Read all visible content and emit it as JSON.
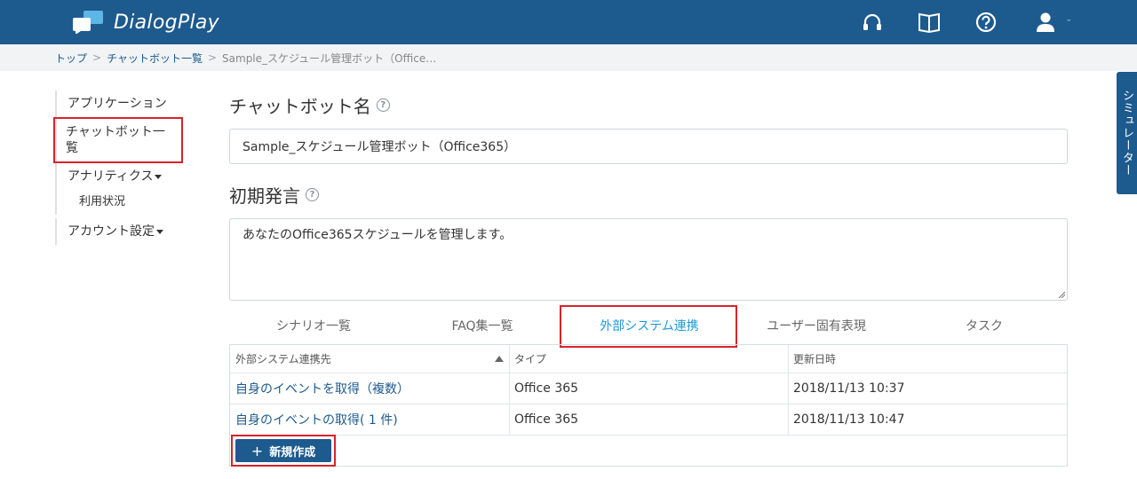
{
  "header": {
    "app_name": "DialogPlay",
    "icons": [
      "headset-icon",
      "book-icon",
      "help-icon",
      "user-icon"
    ],
    "accent_color": "#1d5a8e"
  },
  "breadcrumb": {
    "items": [
      "トップ",
      "チャットボット一覧"
    ],
    "current": "Sample_スケジュール管理ボット（Office…"
  },
  "sidebar": {
    "application": "アプリケーション",
    "chatbot_list": "チャットボット一覧",
    "analytics": "アナリティクス",
    "usage": "利用状況",
    "account": "アカウント設定"
  },
  "form": {
    "name_label": "チャットボット名",
    "name_value": "Sample_スケジュール管理ボット（Office365）",
    "initial_label": "初期発言",
    "initial_value": "あなたのOffice365スケジュールを管理します。"
  },
  "tabs": [
    "シナリオ一覧",
    "FAQ集一覧",
    "外部システム連携",
    "ユーザー固有表現",
    "タスク"
  ],
  "table": {
    "headers": [
      "外部システム連携先",
      "タイプ",
      "更新日時"
    ],
    "rows": [
      [
        "自身のイベントを取得（複数）",
        "Office 365",
        "2018/11/13 10:37"
      ],
      [
        "自身のイベントの取得( 1 件)",
        "Office 365",
        "2018/11/13 10:47"
      ]
    ]
  },
  "new_button": "新規作成",
  "simulator": "シミュレーター"
}
